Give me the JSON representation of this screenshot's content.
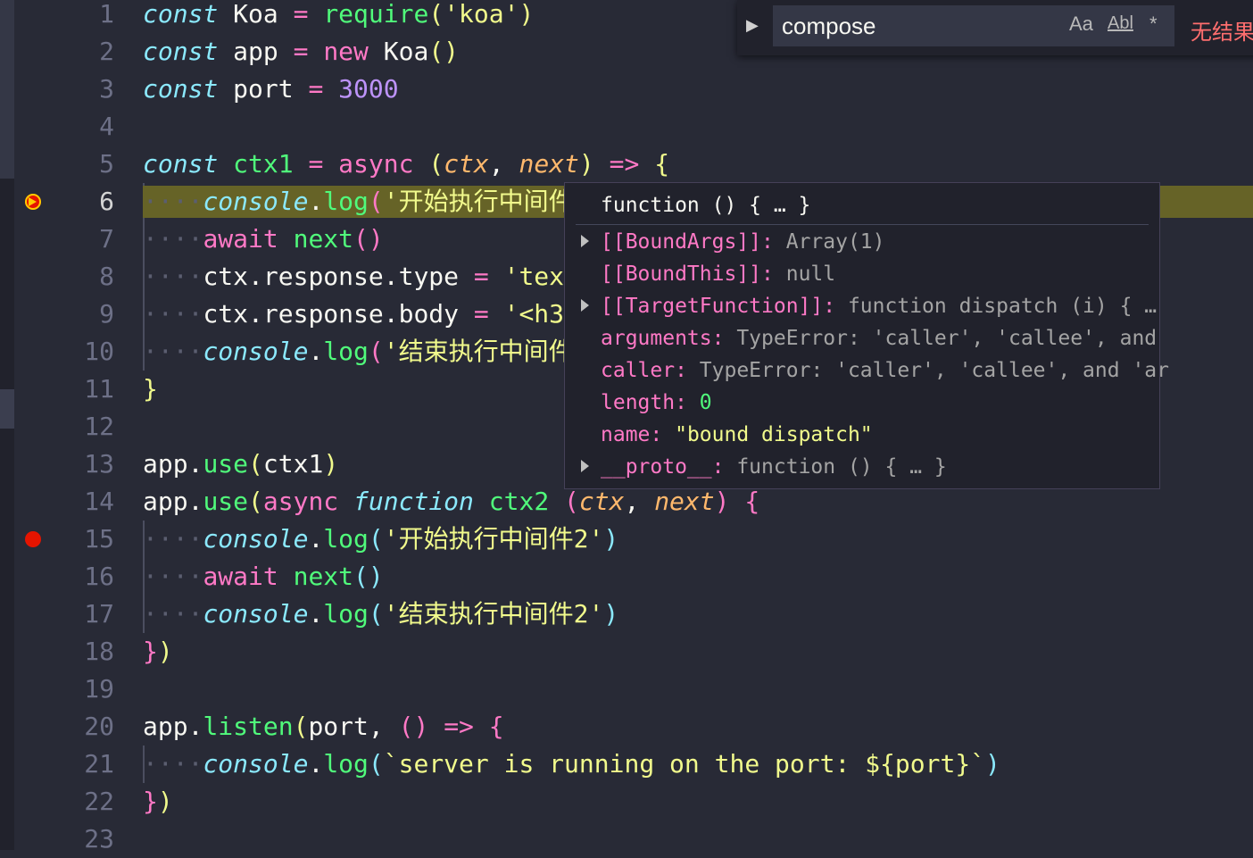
{
  "find": {
    "query": "compose",
    "match_case": "Aa",
    "whole_word": "Abl",
    "regex": "*",
    "status": "无结果"
  },
  "hover": {
    "title": "function () { … }",
    "rows": [
      {
        "key": "[[BoundArgs]]",
        "sep": ": ",
        "value": "Array(1)",
        "expandable": true
      },
      {
        "key": "[[BoundThis]]",
        "sep": ": ",
        "value": "null",
        "expandable": false
      },
      {
        "key": "[[TargetFunction]]",
        "sep": ": ",
        "value": "function dispatch (i) { …",
        "expandable": true
      },
      {
        "key": "arguments",
        "sep": ": ",
        "value": "TypeError: 'caller', 'callee', and",
        "expandable": false
      },
      {
        "key": "caller",
        "sep": ": ",
        "value": "TypeError: 'caller', 'callee', and 'ar",
        "expandable": false
      },
      {
        "key": "length",
        "sep": ": ",
        "value": "0",
        "expandable": false
      },
      {
        "key": "name",
        "sep": ": ",
        "value": "\"bound dispatch\"",
        "expandable": false
      },
      {
        "key": "__proto__",
        "sep": ": ",
        "value": "function () { … }",
        "expandable": true
      }
    ]
  },
  "editor": {
    "current_line": 6,
    "breakpoints": [
      6,
      15
    ],
    "lines": [
      {
        "n": "1",
        "tokens": [
          [
            "kw-it",
            "const"
          ],
          [
            "fg",
            " Koa "
          ],
          [
            "pink",
            "="
          ],
          [
            "fg",
            " "
          ],
          [
            "green",
            "require"
          ],
          [
            "brY",
            "("
          ],
          [
            "yellow",
            "'koa'"
          ],
          [
            "brY",
            ")"
          ]
        ]
      },
      {
        "n": "2",
        "tokens": [
          [
            "kw-it",
            "const"
          ],
          [
            "fg",
            " app "
          ],
          [
            "pink",
            "="
          ],
          [
            "fg",
            " "
          ],
          [
            "pink",
            "new"
          ],
          [
            "fg",
            " Koa"
          ],
          [
            "brY",
            "()"
          ]
        ]
      },
      {
        "n": "3",
        "tokens": [
          [
            "kw-it",
            "const"
          ],
          [
            "fg",
            " port "
          ],
          [
            "pink",
            "="
          ],
          [
            "fg",
            " "
          ],
          [
            "purple",
            "3000"
          ]
        ]
      },
      {
        "n": "4",
        "tokens": []
      },
      {
        "n": "5",
        "tokens": [
          [
            "kw-it",
            "const"
          ],
          [
            "fg",
            " "
          ],
          [
            "green",
            "ctx1"
          ],
          [
            "fg",
            " "
          ],
          [
            "pink",
            "="
          ],
          [
            "fg",
            " "
          ],
          [
            "pink",
            "async"
          ],
          [
            "fg",
            " "
          ],
          [
            "brY",
            "("
          ],
          [
            "orange-it",
            "ctx"
          ],
          [
            "fg",
            ", "
          ],
          [
            "orange-it",
            "next"
          ],
          [
            "brY",
            ")"
          ],
          [
            "fg",
            " "
          ],
          [
            "pink",
            "=>"
          ],
          [
            "fg",
            " "
          ],
          [
            "brY",
            "{"
          ]
        ]
      },
      {
        "n": "6",
        "tokens": [
          [
            "ws",
            "····"
          ],
          [
            "kw-it",
            "console"
          ],
          [
            "fg",
            "."
          ],
          [
            "green",
            "log"
          ],
          [
            "brP",
            "("
          ],
          [
            "yellow",
            "'开始执行中间件"
          ]
        ]
      },
      {
        "n": "7",
        "tokens": [
          [
            "ws",
            "····"
          ],
          [
            "pink",
            "await"
          ],
          [
            "fg",
            " "
          ],
          [
            "green",
            "next"
          ],
          [
            "brP",
            "()"
          ]
        ]
      },
      {
        "n": "8",
        "tokens": [
          [
            "ws",
            "····"
          ],
          [
            "fg",
            "ctx.response.type "
          ],
          [
            "pink",
            "="
          ],
          [
            "fg",
            " "
          ],
          [
            "yellow",
            "'tex"
          ]
        ]
      },
      {
        "n": "9",
        "tokens": [
          [
            "ws",
            "····"
          ],
          [
            "fg",
            "ctx.response.body "
          ],
          [
            "pink",
            "="
          ],
          [
            "fg",
            " "
          ],
          [
            "yellow",
            "'<h3"
          ]
        ]
      },
      {
        "n": "10",
        "tokens": [
          [
            "ws",
            "····"
          ],
          [
            "kw-it",
            "console"
          ],
          [
            "fg",
            "."
          ],
          [
            "green",
            "log"
          ],
          [
            "brP",
            "("
          ],
          [
            "yellow",
            "'结束执行中间件"
          ]
        ]
      },
      {
        "n": "11",
        "tokens": [
          [
            "brY",
            "}"
          ]
        ]
      },
      {
        "n": "12",
        "tokens": []
      },
      {
        "n": "13",
        "tokens": [
          [
            "fg",
            "app."
          ],
          [
            "green",
            "use"
          ],
          [
            "brY",
            "("
          ],
          [
            "fg",
            "ctx1"
          ],
          [
            "brY",
            ")"
          ]
        ]
      },
      {
        "n": "14",
        "tokens": [
          [
            "fg",
            "app."
          ],
          [
            "green",
            "use"
          ],
          [
            "brY",
            "("
          ],
          [
            "pink",
            "async"
          ],
          [
            "fg",
            " "
          ],
          [
            "kw-it",
            "function"
          ],
          [
            "fg",
            " "
          ],
          [
            "green",
            "ctx2"
          ],
          [
            "fg",
            " "
          ],
          [
            "brP",
            "("
          ],
          [
            "orange-it",
            "ctx"
          ],
          [
            "fg",
            ", "
          ],
          [
            "orange-it",
            "next"
          ],
          [
            "brP",
            ")"
          ],
          [
            "fg",
            " "
          ],
          [
            "brP",
            "{"
          ]
        ]
      },
      {
        "n": "15",
        "tokens": [
          [
            "ws",
            "····"
          ],
          [
            "kw-it",
            "console"
          ],
          [
            "fg",
            "."
          ],
          [
            "green",
            "log"
          ],
          [
            "brB",
            "("
          ],
          [
            "yellow",
            "'开始执行中间件2'"
          ],
          [
            "brB",
            ")"
          ]
        ]
      },
      {
        "n": "16",
        "tokens": [
          [
            "ws",
            "····"
          ],
          [
            "pink",
            "await"
          ],
          [
            "fg",
            " "
          ],
          [
            "green",
            "next"
          ],
          [
            "brB",
            "()"
          ]
        ]
      },
      {
        "n": "17",
        "tokens": [
          [
            "ws",
            "····"
          ],
          [
            "kw-it",
            "console"
          ],
          [
            "fg",
            "."
          ],
          [
            "green",
            "log"
          ],
          [
            "brB",
            "("
          ],
          [
            "yellow",
            "'结束执行中间件2'"
          ],
          [
            "brB",
            ")"
          ]
        ]
      },
      {
        "n": "18",
        "tokens": [
          [
            "brP",
            "}"
          ],
          [
            "brY",
            ")"
          ]
        ]
      },
      {
        "n": "19",
        "tokens": []
      },
      {
        "n": "20",
        "tokens": [
          [
            "fg",
            "app."
          ],
          [
            "green",
            "listen"
          ],
          [
            "brY",
            "("
          ],
          [
            "fg",
            "port, "
          ],
          [
            "brP",
            "()"
          ],
          [
            "fg",
            " "
          ],
          [
            "pink",
            "=>"
          ],
          [
            "fg",
            " "
          ],
          [
            "brP",
            "{"
          ]
        ]
      },
      {
        "n": "21",
        "tokens": [
          [
            "ws",
            "····"
          ],
          [
            "kw-it",
            "console"
          ],
          [
            "fg",
            "."
          ],
          [
            "green",
            "log"
          ],
          [
            "brB",
            "("
          ],
          [
            "yellow",
            "`server is running on the port: ${port}`"
          ],
          [
            "brB",
            ")"
          ]
        ]
      },
      {
        "n": "22",
        "tokens": [
          [
            "brP",
            "}"
          ],
          [
            "brY",
            ")"
          ]
        ]
      },
      {
        "n": "23",
        "tokens": []
      }
    ]
  }
}
